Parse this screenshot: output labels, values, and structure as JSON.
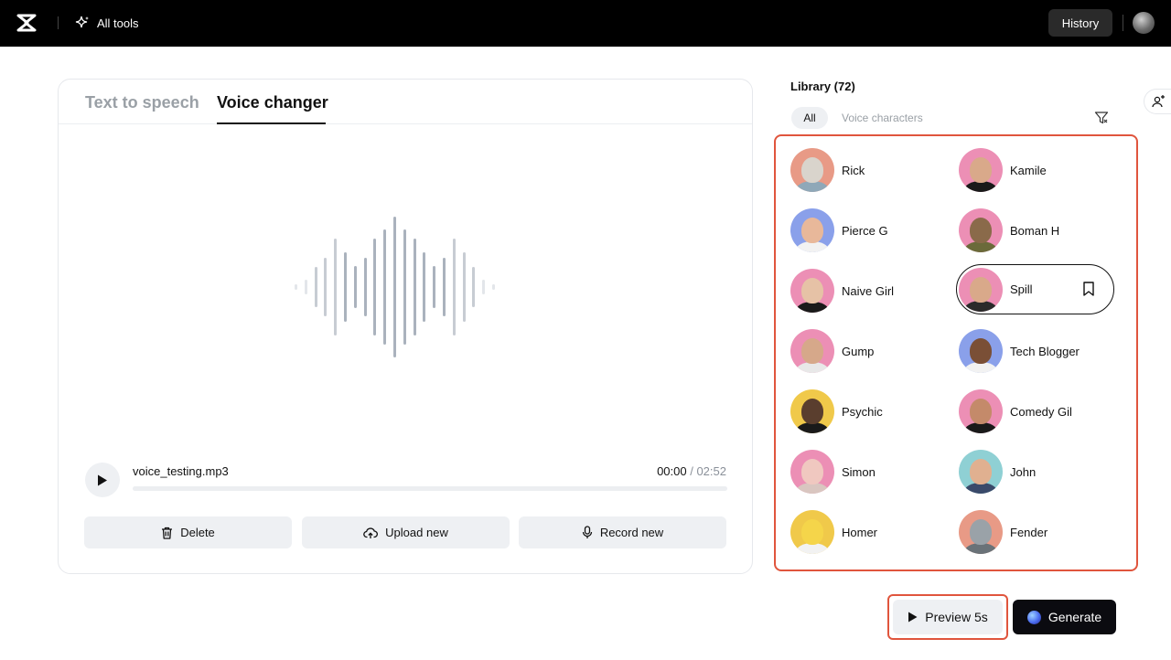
{
  "topbar": {
    "all_tools_label": "All tools",
    "history_label": "History"
  },
  "tabs": [
    {
      "label": "Text to speech",
      "active": false
    },
    {
      "label": "Voice changer",
      "active": true
    }
  ],
  "player": {
    "filename": "voice_testing.mp3",
    "current_time": "00:00",
    "separator": " / ",
    "duration": "02:52",
    "progress": 0
  },
  "actions": {
    "delete_label": "Delete",
    "upload_label": "Upload new",
    "record_label": "Record new"
  },
  "library": {
    "title": "Library (72)",
    "filters": [
      {
        "label": "All",
        "active": true
      },
      {
        "label": "Voice characters",
        "active": false
      }
    ],
    "voices": [
      {
        "name": "Rick",
        "bg": "#e89a86",
        "face": "#d9d4cc",
        "body": "#8fa8b8"
      },
      {
        "name": "Kamile",
        "bg": "#ec8fb5",
        "face": "#d9a98a",
        "body": "#1a1a1a"
      },
      {
        "name": "Pierce G",
        "bg": "#8aa0ea",
        "face": "#e8b89a",
        "body": "#f2f2f2"
      },
      {
        "name": "Boman H",
        "bg": "#ec8fb5",
        "face": "#8a6a4a",
        "body": "#6b6a3a"
      },
      {
        "name": "Naive Girl",
        "bg": "#ec8fb5",
        "face": "#e6c2a6",
        "body": "#1a1a1a"
      },
      {
        "name": "Spill",
        "bg": "#ec8fb5",
        "face": "#d9a98a",
        "body": "#2a2a2a",
        "selected": true
      },
      {
        "name": "Gump",
        "bg": "#ec8fb5",
        "face": "#d6a88a",
        "body": "#e8e8e8"
      },
      {
        "name": "Tech Blogger",
        "bg": "#8aa0ea",
        "face": "#7a4f36",
        "body": "#f2f2f2"
      },
      {
        "name": "Psychic",
        "bg": "#f0c94a",
        "face": "#5a3e2e",
        "body": "#1a1a1a"
      },
      {
        "name": "Comedy Gil",
        "bg": "#ec8fb5",
        "face": "#c48a6a",
        "body": "#1a1a1a"
      },
      {
        "name": "Simon",
        "bg": "#ec8fb5",
        "face": "#f0c8c0",
        "body": "#d9c6c0"
      },
      {
        "name": "John",
        "bg": "#8fd0d4",
        "face": "#e0b090",
        "body": "#3a4a6a"
      },
      {
        "name": "Homer",
        "bg": "#f0c94a",
        "face": "#f5d54a",
        "body": "#f2f2f2"
      },
      {
        "name": "Fender",
        "bg": "#e89a86",
        "face": "#9aa2a8",
        "body": "#6a7278"
      }
    ]
  },
  "footer": {
    "preview_label": "Preview 5s",
    "generate_label": "Generate"
  },
  "colors": {
    "accent_outline": "#e0553d",
    "wave_bar": "#aab2bd"
  }
}
